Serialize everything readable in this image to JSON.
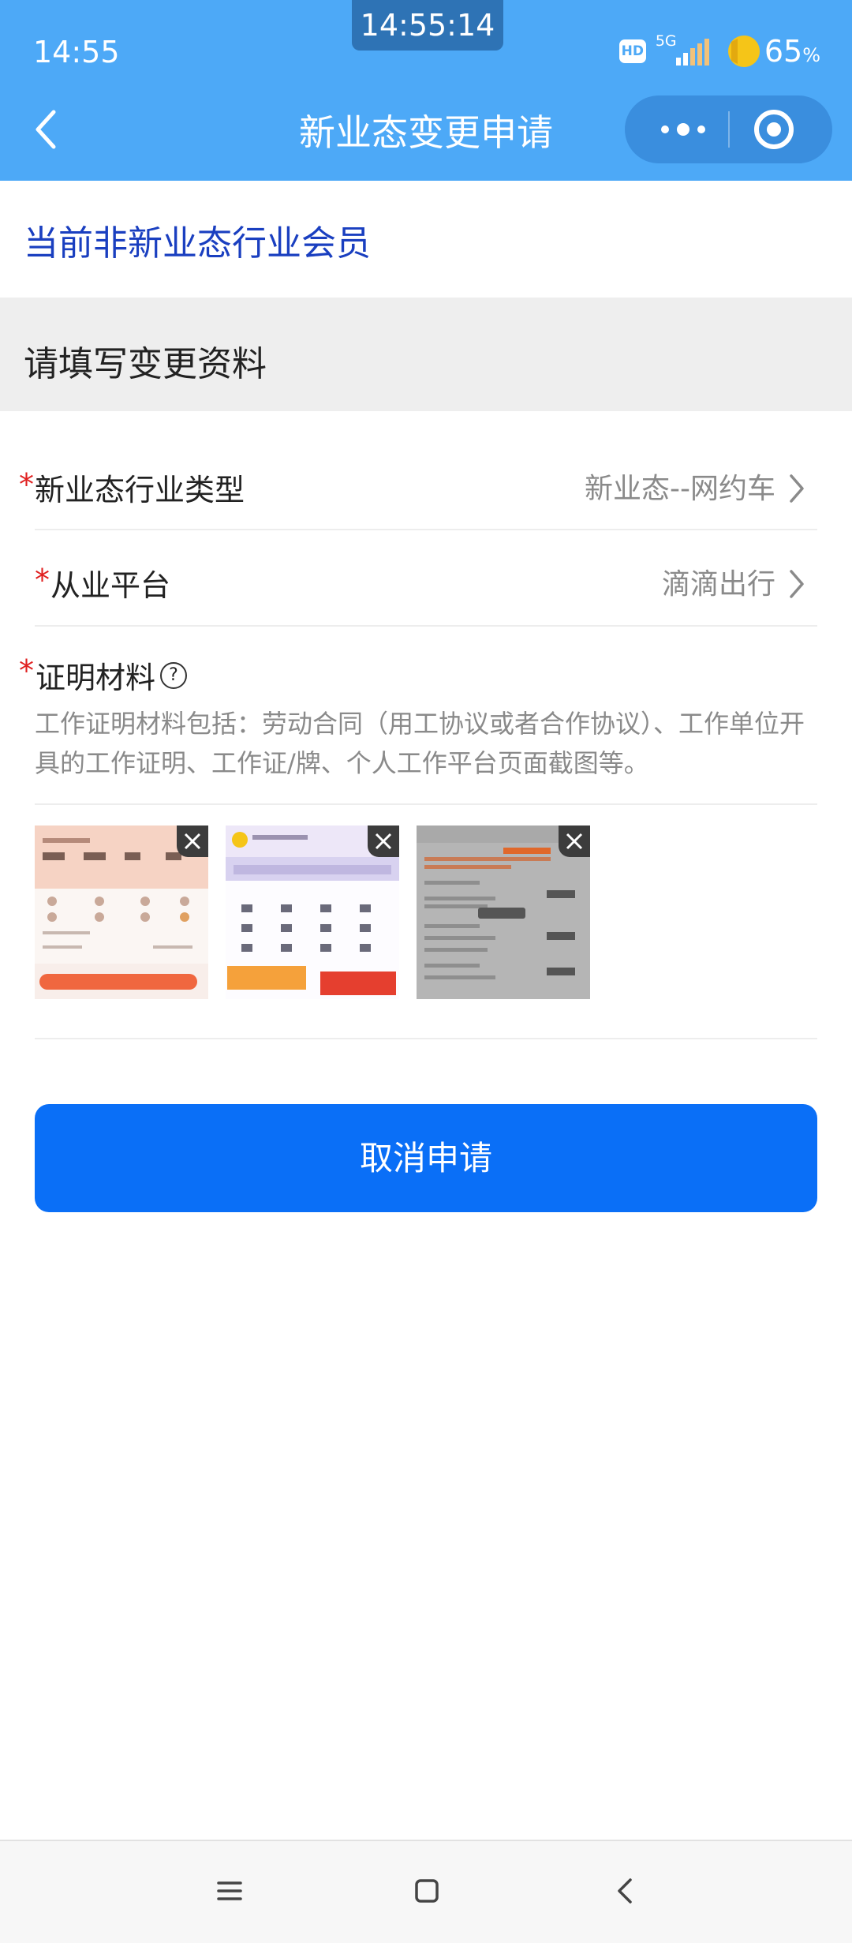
{
  "status_bar": {
    "time": "14:55",
    "clock_overlay": "14:55:14",
    "hd_badge": "HD",
    "network": "5G",
    "battery_percent": "65",
    "battery_unit": "%"
  },
  "nav": {
    "title": "新业态变更申请",
    "back_icon": "chevron-left-icon",
    "more_icon": "more-dots-icon",
    "close_icon": "target-close-icon"
  },
  "member_status": "当前非新业态行业会员",
  "section_header": "请填写变更资料",
  "form": {
    "industry_type": {
      "required_mark": "*",
      "label": "新业态行业类型",
      "value": "新业态--网约车"
    },
    "platform": {
      "required_mark": "*",
      "label": "从业平台",
      "value": "滴滴出行"
    },
    "proof": {
      "required_mark": "*",
      "label": "证明材料",
      "help_icon": "question-circle-icon",
      "help_glyph": "?",
      "description": "工作证明材料包括：劳动合同（用工协议或者合作协议）、工作单位开具的工作证明、工作证/牌、个人工作平台页面截图等。",
      "attachments": [
        {
          "name": "screenshot-1",
          "delete_icon": "close-icon",
          "top_color": "#f6d3c4",
          "accent": "#f0673f"
        },
        {
          "name": "screenshot-2",
          "delete_icon": "close-icon",
          "top_color": "#d8d2f0",
          "accent": "#e53f2f"
        },
        {
          "name": "screenshot-3",
          "delete_icon": "close-icon",
          "top_color": "#a9a9a9",
          "accent": "#e0682b"
        }
      ]
    }
  },
  "cancel_button": "取消申请",
  "system_nav": {
    "menu_icon": "menu-icon",
    "home_icon": "home-square-icon",
    "back_icon": "back-triangle-icon"
  },
  "colors": {
    "header_blue": "#4da9f7",
    "button_blue": "#0a6ff7",
    "status_text_blue": "#1a3fc0",
    "required_red": "#e02020"
  }
}
